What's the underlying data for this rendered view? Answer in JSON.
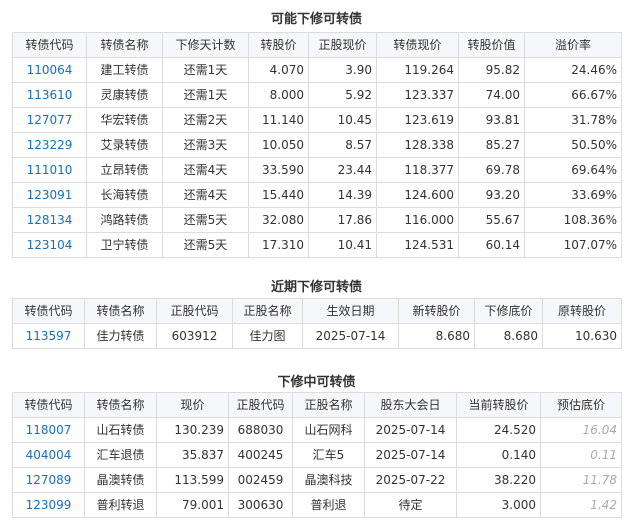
{
  "section1": {
    "title": "可能下修可转债",
    "headers": [
      "转债代码",
      "转债名称",
      "下修天计数",
      "转股价",
      "正股现价",
      "转债现价",
      "转股价值",
      "溢价率"
    ],
    "rows": [
      [
        "110064",
        "建工转债",
        "还需1天",
        "4.070",
        "3.90",
        "119.264",
        "95.82",
        "24.46%"
      ],
      [
        "113610",
        "灵康转债",
        "还需1天",
        "8.000",
        "5.92",
        "123.337",
        "74.00",
        "66.67%"
      ],
      [
        "127077",
        "华宏转债",
        "还需2天",
        "11.140",
        "10.45",
        "123.619",
        "93.81",
        "31.78%"
      ],
      [
        "123229",
        "艾录转债",
        "还需3天",
        "10.050",
        "8.57",
        "128.338",
        "85.27",
        "50.50%"
      ],
      [
        "111010",
        "立昂转债",
        "还需4天",
        "33.590",
        "23.44",
        "118.377",
        "69.78",
        "69.64%"
      ],
      [
        "123091",
        "长海转债",
        "还需4天",
        "15.440",
        "14.39",
        "124.600",
        "93.20",
        "33.69%"
      ],
      [
        "128134",
        "鸿路转债",
        "还需5天",
        "32.080",
        "17.86",
        "116.000",
        "55.67",
        "108.36%"
      ],
      [
        "123104",
        "卫宁转债",
        "还需5天",
        "17.310",
        "10.41",
        "124.531",
        "60.14",
        "107.07%"
      ]
    ]
  },
  "section2": {
    "title": "近期下修可转债",
    "headers": [
      "转债代码",
      "转债名称",
      "正股代码",
      "正股名称",
      "生效日期",
      "新转股价",
      "下修底价",
      "原转股价"
    ],
    "rows": [
      [
        "113597",
        "佳力转债",
        "603912",
        "佳力图",
        "2025-07-14",
        "8.680",
        "8.680",
        "10.630"
      ]
    ]
  },
  "section3": {
    "title": "下修中可转债",
    "headers": [
      "转债代码",
      "转债名称",
      "现价",
      "正股代码",
      "正股名称",
      "股东大会日",
      "当前转股价",
      "预估底价"
    ],
    "rows": [
      [
        "118007",
        "山石转债",
        "130.239",
        "688030",
        "山石网科",
        "2025-07-14",
        "24.520",
        "16.04"
      ],
      [
        "404004",
        "汇车退债",
        "35.837",
        "400245",
        "汇车5",
        "2025-07-14",
        "0.140",
        "0.11"
      ],
      [
        "127089",
        "晶澳转债",
        "113.599",
        "002459",
        "晶澳科技",
        "2025-07-22",
        "38.220",
        "11.78"
      ],
      [
        "123099",
        "普利转退",
        "79.001",
        "300630",
        "普利退",
        "待定",
        "3.000",
        "1.42"
      ]
    ]
  }
}
